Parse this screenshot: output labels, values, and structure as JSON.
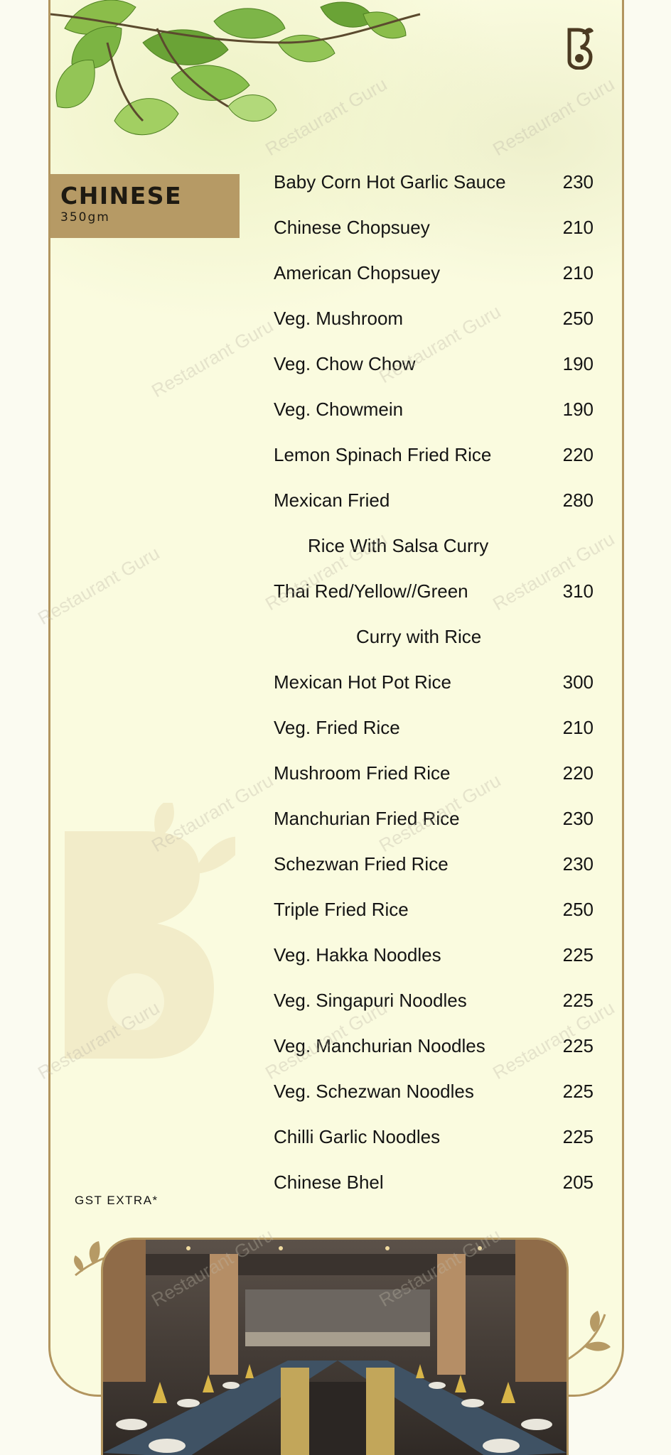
{
  "category": {
    "title": "CHINESE",
    "subtitle": "350gm"
  },
  "items": [
    {
      "name": "Baby Corn Hot Garlic Sauce",
      "price": "230"
    },
    {
      "name": "Chinese Chopsuey",
      "price": "210"
    },
    {
      "name": "American Chopsuey",
      "price": "210"
    },
    {
      "name": "Veg. Mushroom",
      "price": "250"
    },
    {
      "name": "Veg. Chow Chow",
      "price": "190"
    },
    {
      "name": "Veg. Chowmein",
      "price": "190"
    },
    {
      "name": "Lemon Spinach Fried Rice",
      "price": "220"
    },
    {
      "name": "Mexican Fried",
      "price": "280"
    },
    {
      "name": "Rice With Salsa Curry",
      "price": ""
    },
    {
      "name": "Thai Red/Yellow//Green",
      "price": "310"
    },
    {
      "name": "Curry with Rice",
      "price": ""
    },
    {
      "name": "Mexican Hot Pot Rice",
      "price": "300"
    },
    {
      "name": "Veg. Fried Rice",
      "price": "210"
    },
    {
      "name": "Mushroom Fried Rice",
      "price": "220"
    },
    {
      "name": "Manchurian Fried Rice",
      "price": "230"
    },
    {
      "name": "Schezwan Fried Rice",
      "price": "230"
    },
    {
      "name": "Triple Fried Rice",
      "price": "250"
    },
    {
      "name": "Veg. Hakka Noodles",
      "price": "225"
    },
    {
      "name": "Veg. Singapuri Noodles",
      "price": "225"
    },
    {
      "name": "Veg. Manchurian Noodles",
      "price": "225"
    },
    {
      "name": "Veg. Schezwan Noodles",
      "price": "225"
    },
    {
      "name": "Chilli  Garlic Noodles",
      "price": "225"
    },
    {
      "name": "Chinese Bhel",
      "price": "205"
    }
  ],
  "footer": {
    "gst_note": "GST EXTRA*"
  },
  "watermark": {
    "text": "Restaurant Guru"
  },
  "colors": {
    "gold": "#b69a65",
    "background": "#fafbdf",
    "text": "#141414"
  }
}
